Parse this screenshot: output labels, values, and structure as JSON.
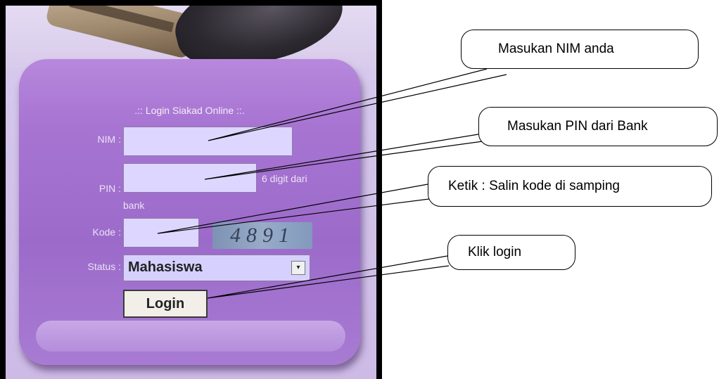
{
  "login_form": {
    "title": ".:: Login Siakad Online ::.",
    "nim_label": "NIM :",
    "nim_value": "",
    "pin_label": "PIN :",
    "pin_value": "",
    "pin_hint_part1": "6 digit dari",
    "pin_hint_part2": "bank",
    "kode_label": "Kode :",
    "kode_value": "",
    "captcha_code": "4891",
    "status_label": "Status :",
    "status_selected": "Mahasiswa",
    "dropdown_arrow": "▾",
    "login_label": "Login"
  },
  "callouts": {
    "nim": "Masukan NIM anda",
    "pin": "Masukan PIN dari Bank",
    "kode": "Ketik : Salin kode di samping",
    "login": "Klik login"
  },
  "colors": {
    "form_bg": "#a774d2",
    "input_bg": "#ddd6ff",
    "captcha_bg": "#8ea2c2"
  }
}
